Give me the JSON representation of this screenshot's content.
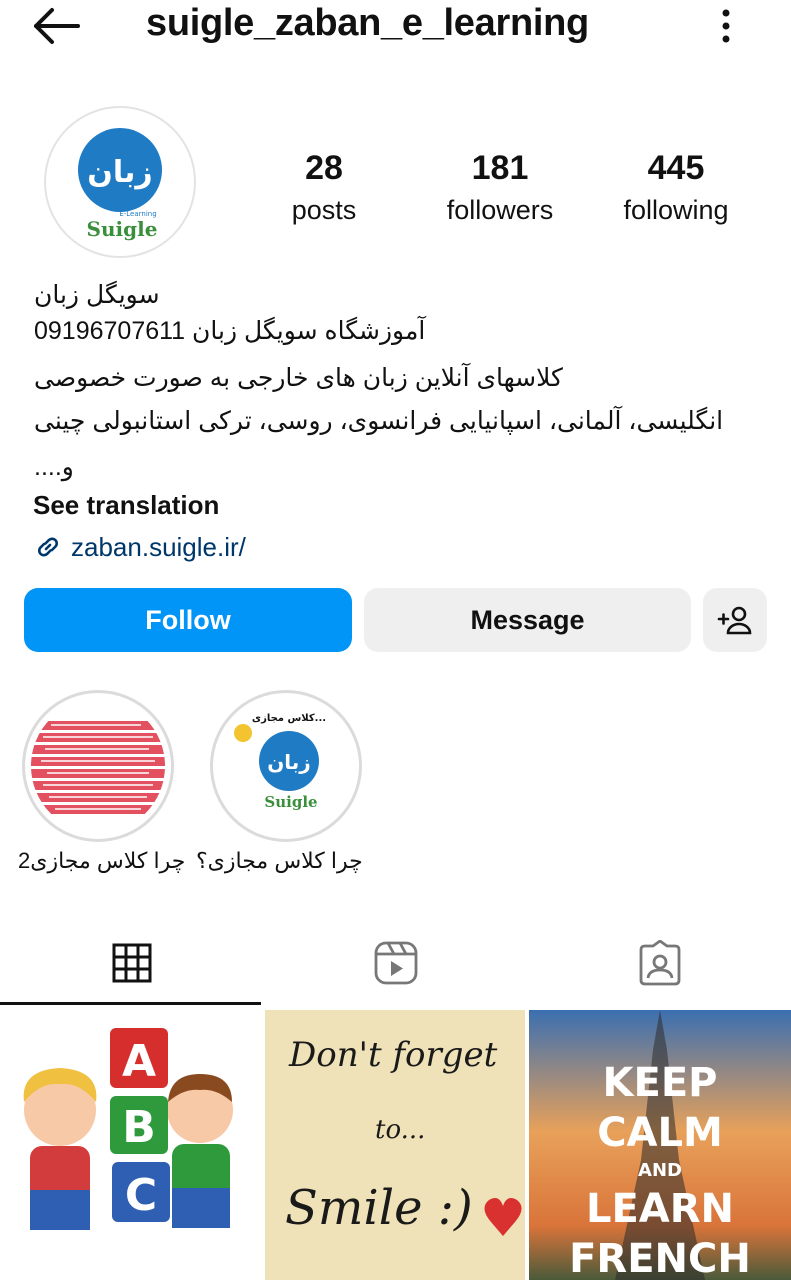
{
  "header": {
    "username": "suigle_zaban_e_learning",
    "back_icon": "arrow-left-icon",
    "more_icon": "more-vertical-icon"
  },
  "profile": {
    "avatar_logo_text": "زبان",
    "avatar_logo_sub": "E-Learning",
    "avatar_brand": "Suigle"
  },
  "stats": {
    "posts": {
      "count": "28",
      "label": "posts"
    },
    "followers": {
      "count": "181",
      "label": "followers"
    },
    "following": {
      "count": "445",
      "label": "following"
    }
  },
  "bio": {
    "name": "سویگل زبان",
    "line1_text": "آموزشگاه سویگل زبان",
    "line1_phone": "09196707611",
    "line2": "کلاسهای آنلاین زبان های خارجی به صورت خصوصی",
    "line3": "انگلیسی، آلمانی، اسپانیایی فرانسوی،  روسی،  ترکی استانبولی چینی",
    "line4": "و....",
    "see_translation": "See translation",
    "link": "zaban.suigle.ir/"
  },
  "actions": {
    "follow": "Follow",
    "message": "Message",
    "add_user_icon": "add-person-icon"
  },
  "highlights": [
    {
      "label": "چرا کلاس مجازی2"
    },
    {
      "label": "چرا کلاس مجازی؟",
      "cover_title": "...کلاس مجازی",
      "cover_brand": "Suigle"
    }
  ],
  "tabs": [
    "grid-icon",
    "reels-icon",
    "tagged-icon"
  ],
  "posts": [
    {
      "letters": [
        "A",
        "B",
        "C"
      ]
    },
    {
      "text_lines": [
        "Don't forget",
        "to...",
        "Smile :)"
      ]
    },
    {
      "text_lines": [
        "KEEP",
        "CALM",
        "AND",
        "LEARN",
        "FRENCH"
      ]
    }
  ],
  "colors": {
    "accent": "#0095f6",
    "link": "#00376b",
    "button_secondary": "#efefef",
    "logo_blue": "#1f7bc4"
  }
}
